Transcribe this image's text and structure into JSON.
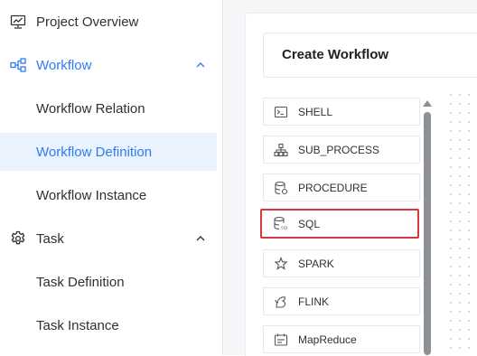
{
  "sidebar": {
    "items": [
      {
        "label": "Project Overview",
        "icon": "presentation-chart-icon"
      },
      {
        "label": "Workflow",
        "icon": "workflow-tree-icon",
        "expanded": true
      },
      {
        "label": "Workflow Relation"
      },
      {
        "label": "Workflow Definition",
        "active": true
      },
      {
        "label": "Workflow Instance"
      },
      {
        "label": "Task",
        "icon": "gear-icon",
        "expanded": true
      },
      {
        "label": "Task Definition"
      },
      {
        "label": "Task Instance"
      }
    ]
  },
  "main": {
    "title": "Create Workflow",
    "palette": [
      {
        "label": "SHELL",
        "icon": "terminal-icon"
      },
      {
        "label": "SUB_PROCESS",
        "icon": "sub-process-icon"
      },
      {
        "label": "PROCEDURE",
        "icon": "database-icon"
      },
      {
        "label": "SQL",
        "icon": "sql-database-icon",
        "highlighted": true
      },
      {
        "label": "SPARK",
        "icon": "spark-star-icon"
      },
      {
        "label": "FLINK",
        "icon": "flink-squirrel-icon"
      },
      {
        "label": "MapReduce",
        "icon": "mapreduce-icon"
      }
    ]
  },
  "colors": {
    "accent": "#2f7bf5",
    "active_bg": "#eaf2fd",
    "highlight_border": "#d9363e",
    "text": "#303133"
  }
}
